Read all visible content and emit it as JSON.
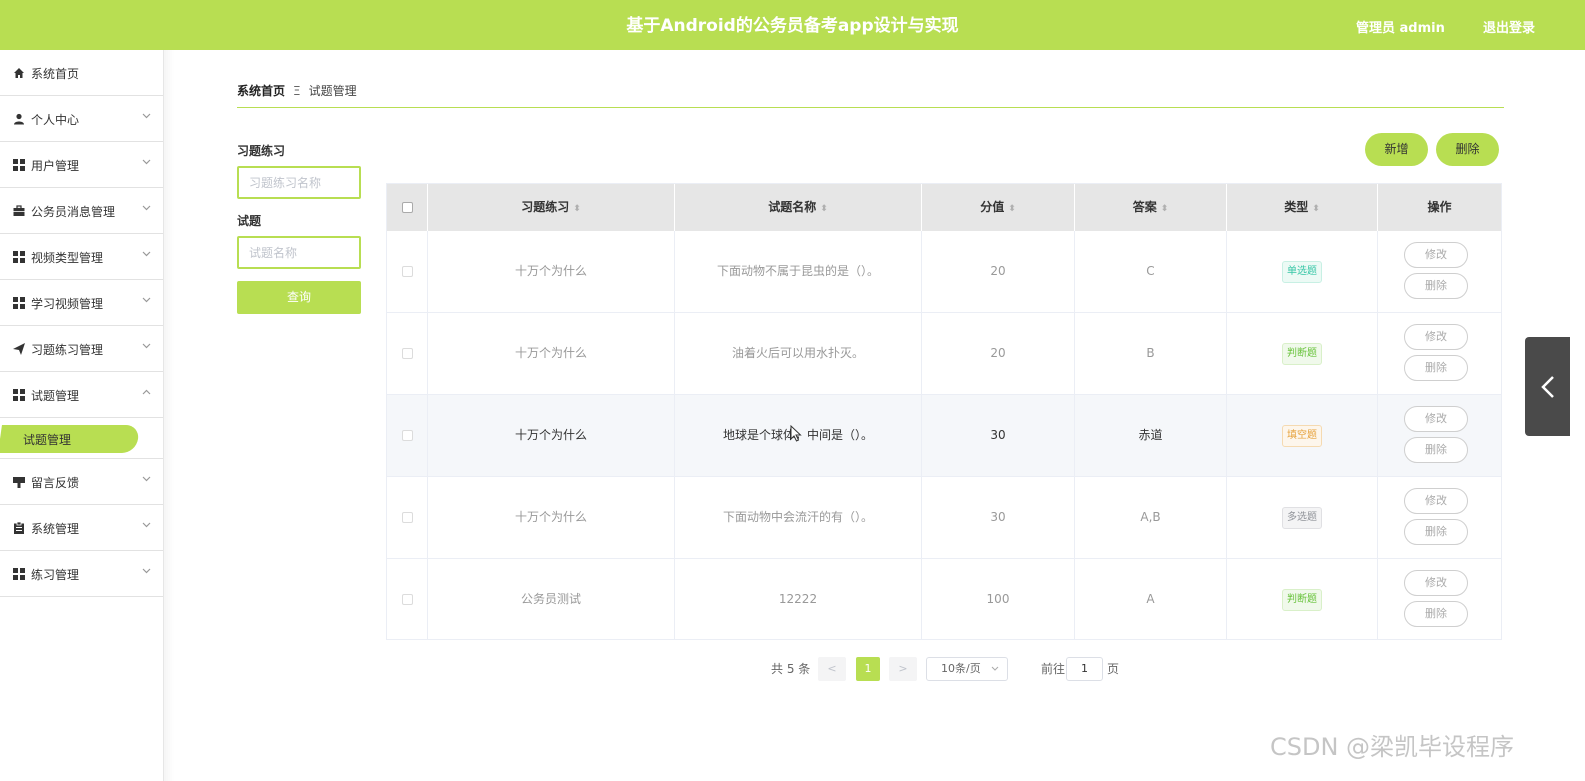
{
  "app": {
    "title": "基于Android的公务员备考app设计与实现",
    "user": "管理员 admin",
    "logout": "退出登录"
  },
  "sidebar": {
    "items": [
      {
        "label": "系统首页",
        "icon": "home-icon",
        "arrow": ""
      },
      {
        "label": "个人中心",
        "icon": "user-icon",
        "arrow": "⌄"
      },
      {
        "label": "用户管理",
        "icon": "grid-icon",
        "arrow": "⌄"
      },
      {
        "label": "公务员消息管理",
        "icon": "briefcase-icon",
        "arrow": "⌄"
      },
      {
        "label": "视频类型管理",
        "icon": "grid-icon",
        "arrow": "⌄"
      },
      {
        "label": "学习视频管理",
        "icon": "grid-icon",
        "arrow": "⌄"
      },
      {
        "label": "习题练习管理",
        "icon": "send-icon",
        "arrow": "⌄"
      },
      {
        "label": "试题管理",
        "icon": "grid-icon",
        "arrow": "⌃"
      },
      {
        "label": "留言反馈",
        "icon": "flag-icon",
        "arrow": "⌄"
      },
      {
        "label": "系统管理",
        "icon": "clipboard-icon",
        "arrow": "⌄"
      },
      {
        "label": "练习管理",
        "icon": "grid-icon",
        "arrow": "⌄"
      }
    ],
    "active_sub": "试题管理"
  },
  "breadcrumb": {
    "home": "系统首页",
    "separator": "Ξ",
    "current": "试题管理"
  },
  "filters": {
    "exercise_label": "习题练习",
    "exercise_placeholder": "习题练习名称",
    "question_label": "试题",
    "question_placeholder": "试题名称",
    "query_label": "查询"
  },
  "actions": {
    "add": "新增",
    "delete": "删除"
  },
  "table": {
    "columns": [
      "习题练习",
      "试题名称",
      "分值",
      "答案",
      "类型",
      "操作"
    ],
    "rows": [
      {
        "exercise": "十万个为什么",
        "question": "下面动物不属于昆虫的是（）。",
        "score": "20",
        "answer": "C",
        "type": "单选题",
        "type_key": "single"
      },
      {
        "exercise": "十万个为什么",
        "question": "油着火后可以用水扑灭。",
        "score": "20",
        "answer": "B",
        "type": "判断题",
        "type_key": "judge"
      },
      {
        "exercise": "十万个为什么",
        "question": "地球是个球体，中间是（）。",
        "score": "30",
        "answer": "赤道",
        "type": "填空题",
        "type_key": "fill"
      },
      {
        "exercise": "十万个为什么",
        "question": "下面动物中会流汗的有（）。",
        "score": "30",
        "answer": "A,B",
        "type": "多选题",
        "type_key": "multi"
      },
      {
        "exercise": "公务员测试",
        "question": "12222",
        "score": "100",
        "answer": "A",
        "type": "判断题",
        "type_key": "judge"
      }
    ],
    "edit_label": "修改",
    "delete_label": "删除"
  },
  "pagination": {
    "total": "共 5 条",
    "prev": "<",
    "current_page": "1",
    "next": ">",
    "page_size": "10条/页",
    "goto_label": "前往",
    "goto_value": "1",
    "page_suffix": "页"
  },
  "side_tab_icon": "chevron-left-icon",
  "watermark": "CSDN @梁凯毕设程序",
  "colors": {
    "accent": "#b8de52",
    "header_bg": "#b8de52",
    "table_header": "#e6e6e6"
  }
}
